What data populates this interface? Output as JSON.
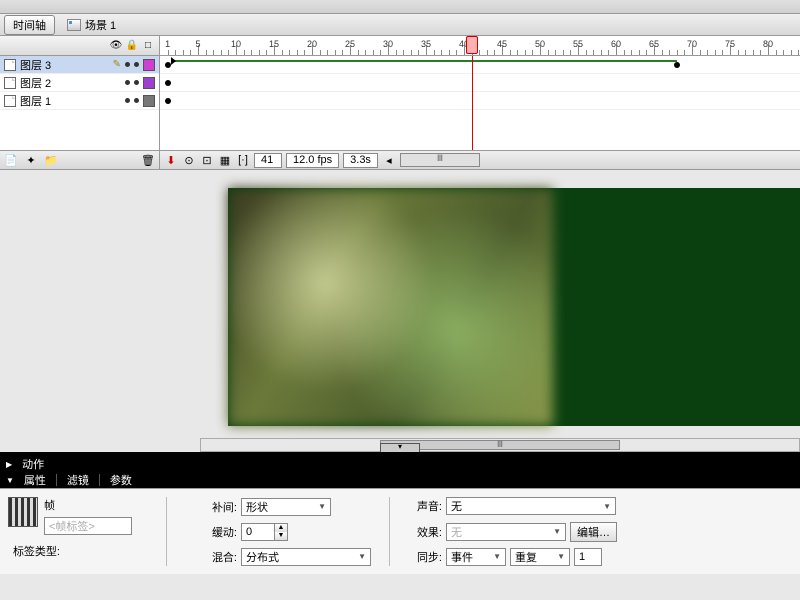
{
  "tabs": {
    "timeline": "时间轴",
    "scene": "场景 1"
  },
  "ruler": {
    "start": 1,
    "end": 85,
    "step": 5,
    "pxPerFrame": 7.6,
    "playhead": 41
  },
  "layers": [
    {
      "name": "图层 3",
      "selected": true,
      "color": "#d040d0",
      "tweenEnd": 68
    },
    {
      "name": "图层 2",
      "selected": false,
      "color": "#a040d0"
    },
    {
      "name": "图层 1",
      "selected": false,
      "color": "#777777"
    }
  ],
  "frameStatus": {
    "current": "41",
    "fps": "12.0 fps",
    "time": "3.3s"
  },
  "actionsPanel": {
    "title": "动作"
  },
  "propsTabs": {
    "properties": "属性",
    "filters": "滤镜",
    "params": "参数"
  },
  "props": {
    "frameLabel": "帧",
    "placeholder": "<帧标签>",
    "labelTypeLabel": "标签类型:",
    "tweenLabel": "补间:",
    "tweenValue": "形状",
    "easeLabel": "缓动:",
    "easeValue": "0",
    "blendLabel": "混合:",
    "blendValue": "分布式",
    "soundLabel": "声音:",
    "soundValue": "无",
    "effectLabel": "效果:",
    "effectValue": "无",
    "editBtn": "编辑…",
    "syncLabel": "同步:",
    "syncValue": "事件",
    "repeatValue": "重复",
    "repeatCount": "1"
  }
}
